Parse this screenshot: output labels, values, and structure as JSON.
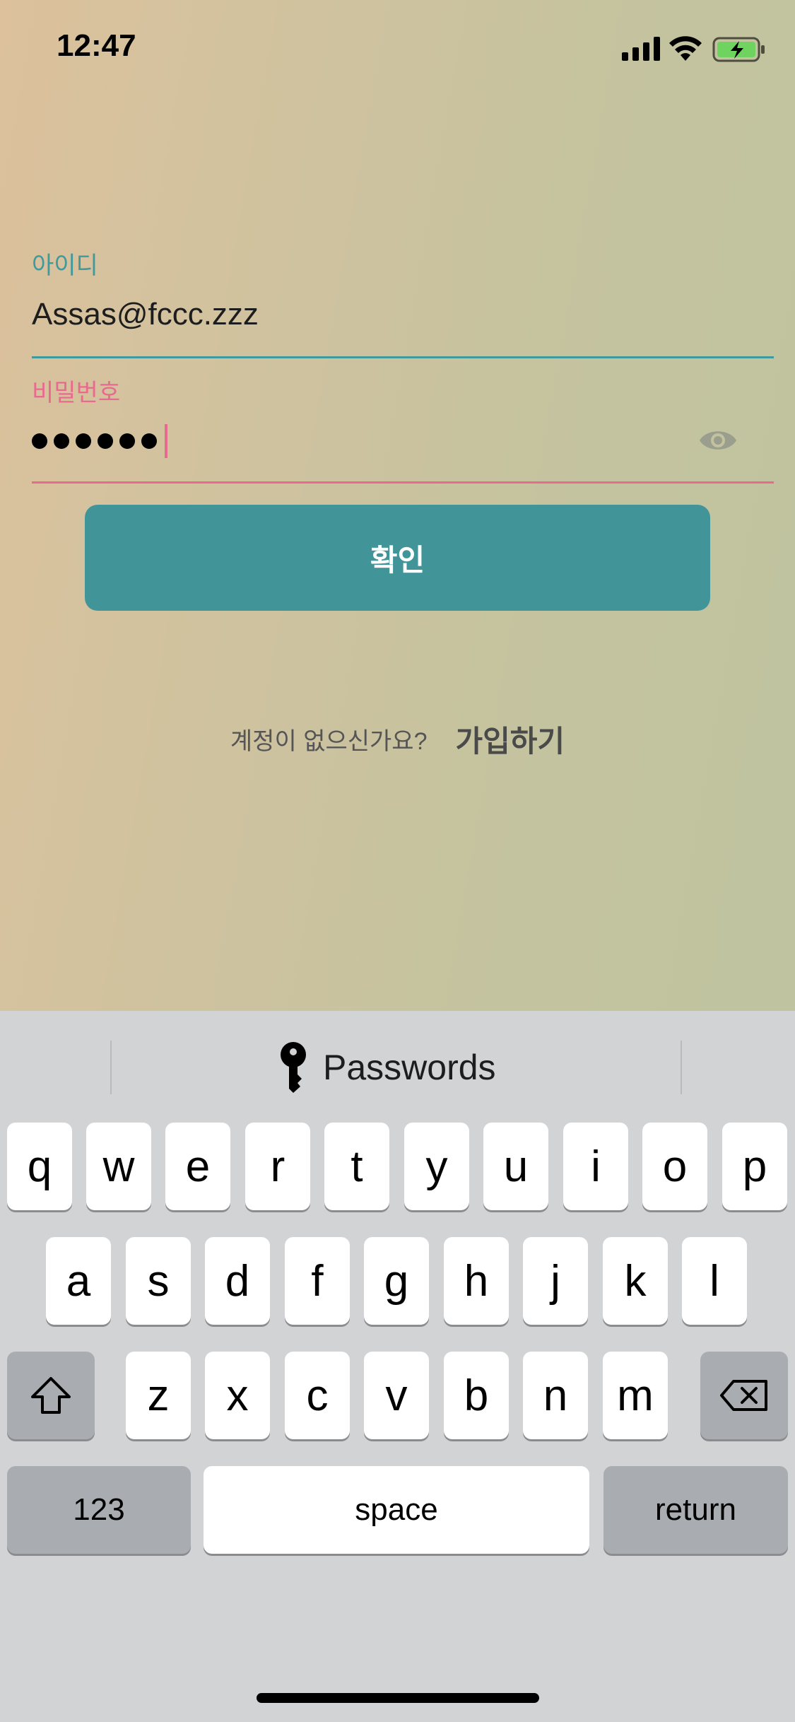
{
  "status_bar": {
    "time": "12:47",
    "icons": [
      "cellular-signal-icon",
      "wifi-icon",
      "battery-charging-icon"
    ]
  },
  "login_form": {
    "id_label": "아이디",
    "id_value": "Assas@fccc.zzz",
    "password_label": "비밀번호",
    "password_mask_count": 6,
    "confirm_label": "확인",
    "no_account_text": "계정이 없으신가요?",
    "signup_label": "가입하기"
  },
  "colors": {
    "accent_teal": "#419599",
    "accent_pink": "#e86a8f"
  },
  "keyboard": {
    "suggestion": "Passwords",
    "row1": [
      "q",
      "w",
      "e",
      "r",
      "t",
      "y",
      "u",
      "i",
      "o",
      "p"
    ],
    "row2": [
      "a",
      "s",
      "d",
      "f",
      "g",
      "h",
      "j",
      "k",
      "l"
    ],
    "row3": [
      "z",
      "x",
      "c",
      "v",
      "b",
      "n",
      "m"
    ],
    "numbers_label": "123",
    "space_label": "space",
    "return_label": "return"
  }
}
